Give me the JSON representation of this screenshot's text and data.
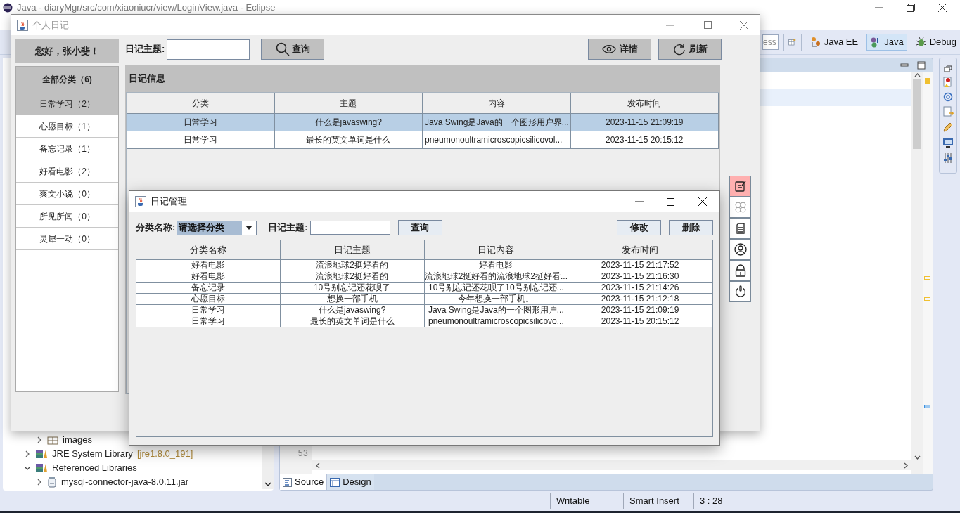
{
  "eclipse": {
    "title": "Java - diaryMgr/src/com/xiaoniucr/view/LoginView.java - Eclipse",
    "search_fragment": "ess",
    "perspectives": [
      {
        "kind": "javaee",
        "label": "Java EE",
        "selected": false
      },
      {
        "kind": "java",
        "label": "Java",
        "selected": true
      },
      {
        "kind": "debug",
        "label": "Debug",
        "selected": false
      }
    ],
    "tree": [
      {
        "children": [
          {
            "label": "images",
            "kind": "package",
            "expanded": false
          }
        ]
      },
      {
        "label": "JRE System Library",
        "note": "[jre1.8.0_191]",
        "kind": "library",
        "expanded": false
      },
      {
        "label": "Referenced Libraries",
        "kind": "library",
        "expanded": true,
        "children": [
          {
            "label": "mysql-connector-java-8.0.11.jar",
            "kind": "jar",
            "expanded": false
          }
        ]
      }
    ],
    "line_number": "53",
    "editor_tabs": [
      {
        "kind": "source",
        "label": "Source",
        "selected": true
      },
      {
        "kind": "design",
        "label": "Design",
        "selected": false
      }
    ],
    "status_bar": [
      "Writable",
      "Smart Insert",
      "3 : 28"
    ]
  },
  "main_window": {
    "title": "个人日记",
    "greeting": "您好，张小斐！",
    "search_label": "日记主题:",
    "search_button": "查询",
    "buttons": [
      {
        "kind": "eye",
        "label": "详情"
      },
      {
        "kind": "refresh",
        "label": "刷新"
      }
    ],
    "categories": [
      {
        "label": "全部分类（6)",
        "kind": "header",
        "selected": false
      },
      {
        "label": "日常学习（2）",
        "kind": "item",
        "selected": true
      },
      {
        "label": "心愿目标（1）",
        "kind": "item",
        "selected": false
      },
      {
        "label": "备忘记录（1）",
        "kind": "item",
        "selected": false
      },
      {
        "label": "好看电影（2）",
        "kind": "item",
        "selected": false
      },
      {
        "label": "爽文小说（0）",
        "kind": "item",
        "selected": false
      },
      {
        "label": "所见所闻（0）",
        "kind": "item",
        "selected": false
      },
      {
        "label": "灵犀一动（0）",
        "kind": "item",
        "selected": false
      }
    ],
    "panel_title": "日记信息",
    "table": {
      "columns": [
        "分类",
        "主题",
        "内容",
        "发布时间"
      ],
      "rows": [
        {
          "cells": [
            "日常学习",
            "什么是javaswing?",
            "Java Swing是Java的一个图形用户界...",
            "2023-11-15 21:09:19"
          ],
          "selected": true
        },
        {
          "cells": [
            "日常学习",
            "最长的英文单词是什么",
            "pneumonoultramicroscopicsilicovol...",
            "2023-11-15 20:15:12"
          ],
          "selected": false
        }
      ]
    },
    "side_buttons": [
      {
        "kind": "note",
        "selected": true
      },
      {
        "kind": "clover",
        "selected": false
      },
      {
        "kind": "document",
        "selected": false
      },
      {
        "kind": "user",
        "selected": false
      },
      {
        "kind": "lock",
        "selected": false
      },
      {
        "kind": "power",
        "selected": false
      }
    ]
  },
  "dialog": {
    "title": "日记管理",
    "category_label": "分类名称:",
    "category_value": "请选择分类",
    "subject_label": "日记主题:",
    "query_button": "查询",
    "buttons": [
      "修改",
      "删除"
    ],
    "table": {
      "columns": [
        "分类名称",
        "日记主题",
        "日记内容",
        "发布时间"
      ],
      "rows": [
        [
          "好看电影",
          "流浪地球2挺好看的",
          "好看电影",
          "2023-11-15 21:17:52"
        ],
        [
          "好看电影",
          "流浪地球2挺好看的",
          "流浪地球2挺好看的流浪地球2挺好看...",
          "2023-11-15 21:16:30"
        ],
        [
          "备忘记录",
          "10号别忘记还花呗了",
          "10号别忘记还花呗了10号别忘记还...",
          "2023-11-15 21:14:26"
        ],
        [
          "心愿目标",
          "想换一部手机",
          "今年想换一部手机。",
          "2023-11-15 21:12:18"
        ],
        [
          "日常学习",
          "什么是javaswing?",
          "Java Swing是Java的一个图形用户...",
          "2023-11-15 21:09:19"
        ],
        [
          "日常学习",
          "最长的英文单词是什么",
          "pneumonoultramicroscopicsilicovo...",
          "2023-11-15 20:15:12"
        ]
      ]
    }
  }
}
